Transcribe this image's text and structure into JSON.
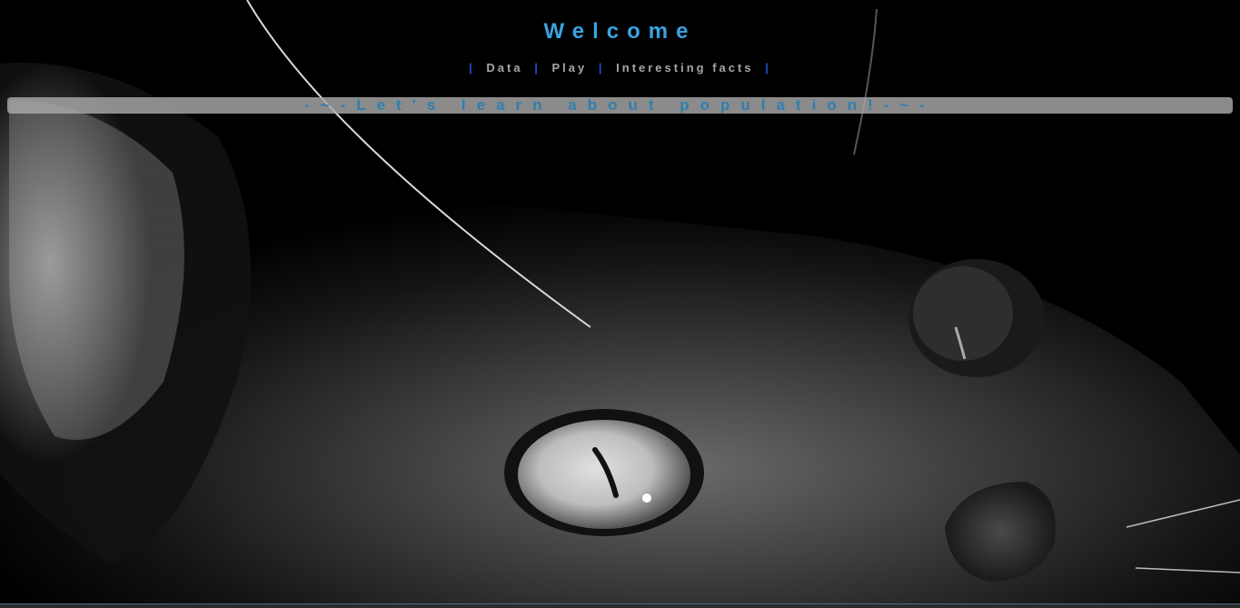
{
  "header": {
    "title": "Welcome"
  },
  "nav": {
    "separator": "|",
    "items": [
      {
        "label": "Data"
      },
      {
        "label": "Play"
      },
      {
        "label": "Interesting facts"
      }
    ]
  },
  "banner": {
    "text": "-~-Let's learn about population!-~-"
  },
  "background": {
    "image": "black-and-white close-up cat face",
    "colors": {
      "title": "#3aa3e0",
      "separator": "#1f4fd6",
      "banner_text": "#2f7fae"
    }
  }
}
